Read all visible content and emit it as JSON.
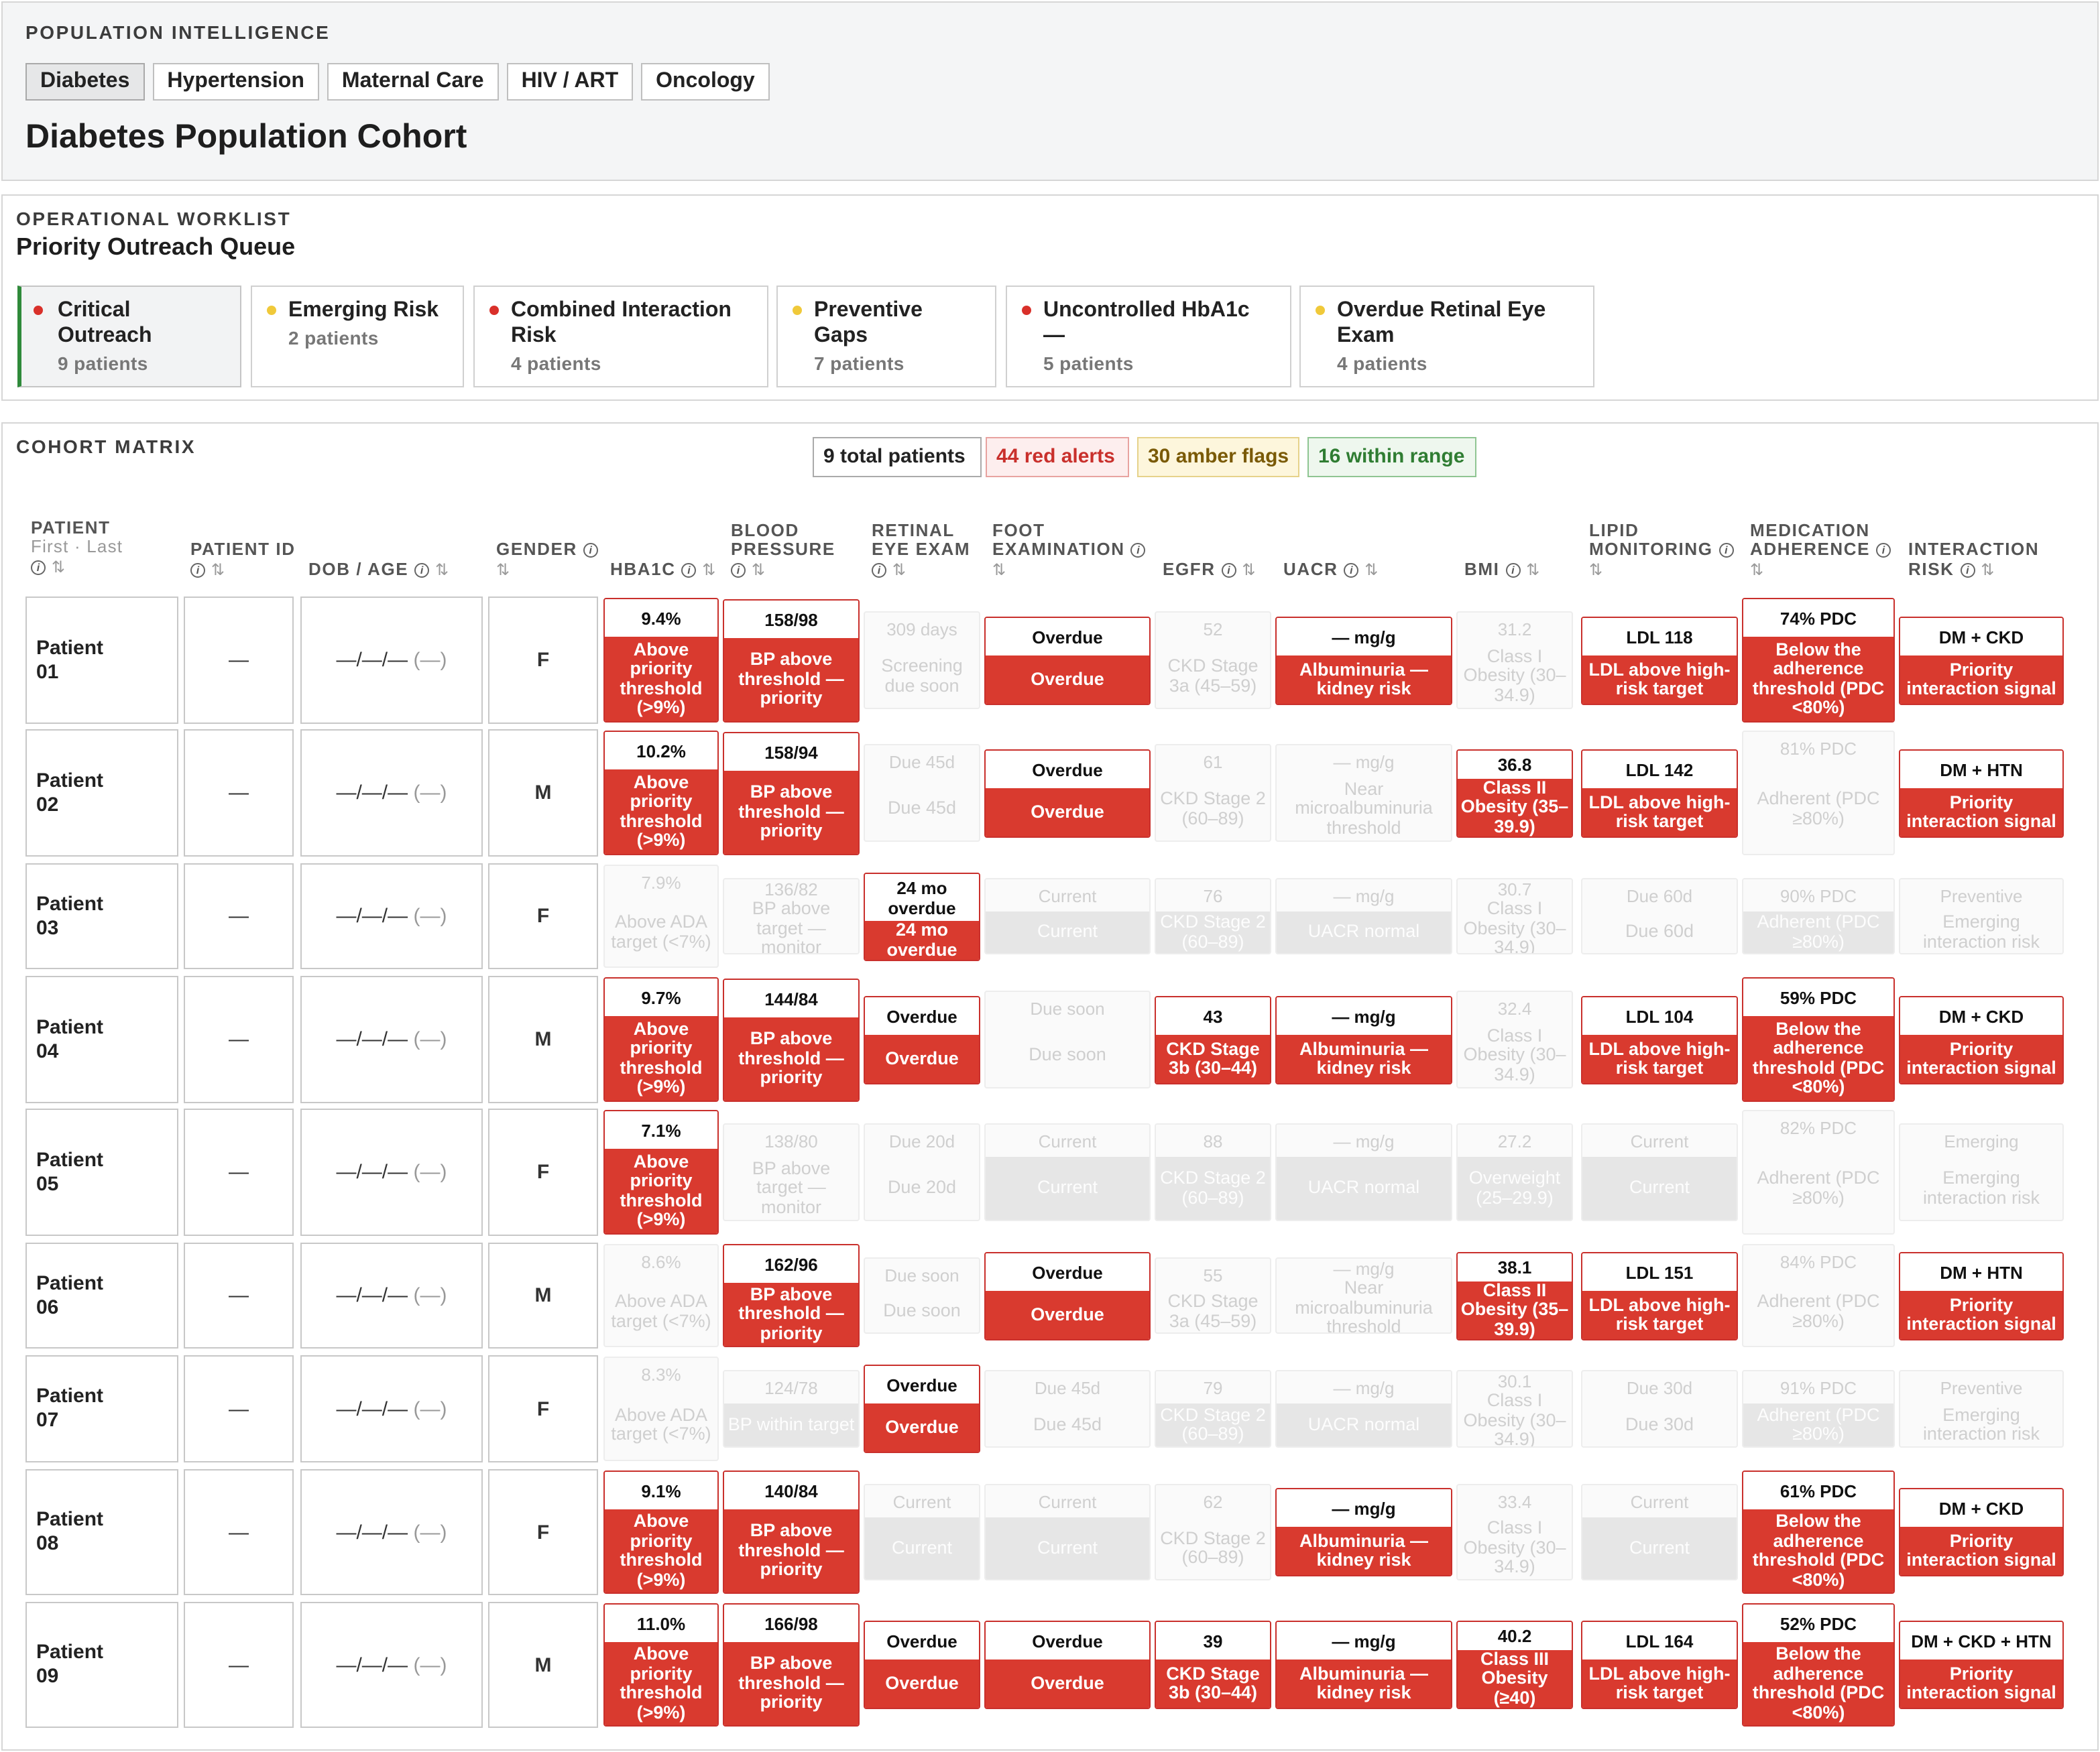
{
  "header": {
    "eyebrow": "POPULATION INTELLIGENCE",
    "title": "Diabetes Population Cohort",
    "tabs": [
      {
        "label": "Diabetes",
        "active": true
      },
      {
        "label": "Hypertension"
      },
      {
        "label": "Maternal Care"
      },
      {
        "label": "HIV / ART"
      },
      {
        "label": "Oncology"
      }
    ]
  },
  "worklist": {
    "eyebrow": "OPERATIONAL WORKLIST",
    "title": "Priority Outreach Queue",
    "queues": [
      {
        "label": "Critical Outreach",
        "count": "9 patients",
        "color": "#d9302a",
        "selected": true
      },
      {
        "label": "Emerging Risk",
        "count": "2 patients",
        "color": "#f0c93a"
      },
      {
        "label": "Combined Interaction Risk",
        "count": "4 patients",
        "color": "#d9302a"
      },
      {
        "label": "Preventive Gaps",
        "count": "7 patients",
        "color": "#f0c93a"
      },
      {
        "label": "Uncontrolled HbA1c —",
        "count": "5 patients",
        "color": "#d9302a"
      },
      {
        "label": "Overdue Retinal Eye Exam",
        "count": "4 patients",
        "color": "#f0c93a"
      }
    ]
  },
  "matrix": {
    "eyebrow": "COHORT MATRIX",
    "summary": [
      {
        "label": "9 total patients",
        "color": "#222",
        "bg": "#ffffff",
        "border": "#aaaaaa"
      },
      {
        "label": "44 red alerts",
        "color": "#c9302c",
        "bg": "#fdeeee",
        "border": "#e8a3a0"
      },
      {
        "label": "30 amber flags",
        "color": "#7a5a06",
        "bg": "#fdf6dc",
        "border": "#e6d28a"
      },
      {
        "label": "16 within range",
        "color": "#2f7d32",
        "bg": "#eef7ee",
        "border": "#8fc592"
      }
    ],
    "columns": [
      {
        "label": "PATIENT",
        "sub": "First · Last"
      },
      {
        "label": "PATIENT ID"
      },
      {
        "label": "DOB / AGE"
      },
      {
        "label": "GENDER"
      },
      {
        "label": "HBA1C"
      },
      {
        "label": "BLOOD PRESSURE"
      },
      {
        "label": "RETINAL EYE EXAM"
      },
      {
        "label": "FOOT EXAMINATION"
      },
      {
        "label": "EGFR"
      },
      {
        "label": "UACR"
      },
      {
        "label": "BMI"
      },
      {
        "label": "LIPID MONITORING"
      },
      {
        "label": "MEDICATION ADHERENCE"
      },
      {
        "label": "INTERACTION RISK"
      }
    ],
    "info_glyph": "i",
    "sort_glyph": "⇅",
    "dash": "—",
    "dob_dash": "—/—/—",
    "age_dash": "(—)",
    "rows": [
      {
        "name": "Patient 01",
        "gender": "F",
        "cells": [
          [
            "red",
            "9.4%",
            "Above priority threshold (>9%)"
          ],
          [
            "red",
            "158/98",
            "BP above threshold — priority"
          ],
          [
            "dim",
            "309 days",
            "Screening due soon"
          ],
          [
            "red",
            "Overdue",
            "Overdue"
          ],
          [
            "dim",
            "52",
            "CKD Stage 3a (45–59)"
          ],
          [
            "red",
            "— mg/g",
            "Albuminuria — kidney risk"
          ],
          [
            "dim",
            "31.2",
            "Class I Obesity (30–34.9)"
          ],
          [
            "red",
            "LDL 118",
            "LDL above high-risk target"
          ],
          [
            "red",
            "74% PDC",
            "Below the adherence threshold (PDC <80%)"
          ],
          [
            "red",
            "DM + CKD",
            "Priority interaction signal"
          ]
        ]
      },
      {
        "name": "Patient 02",
        "gender": "M",
        "cells": [
          [
            "red",
            "10.2%",
            "Above priority threshold (>9%)"
          ],
          [
            "red",
            "158/94",
            "BP above threshold — priority"
          ],
          [
            "dim",
            "Due 45d",
            "Due 45d"
          ],
          [
            "red",
            "Overdue",
            "Overdue"
          ],
          [
            "dim",
            "61",
            "CKD Stage 2 (60–89)"
          ],
          [
            "dim",
            "— mg/g",
            "Near microalbuminuria threshold"
          ],
          [
            "red",
            "36.8",
            "Class II Obesity (35–39.9)"
          ],
          [
            "red",
            "LDL 142",
            "LDL above high-risk target"
          ],
          [
            "dim",
            "81% PDC",
            "Adherent (PDC ≥80%)"
          ],
          [
            "red",
            "DM + HTN",
            "Priority interaction signal"
          ]
        ]
      },
      {
        "name": "Patient 03",
        "gender": "F",
        "cells": [
          [
            "dim",
            "7.9%",
            "Above ADA target (<7%)"
          ],
          [
            "dim",
            "136/82",
            "BP above target — monitor"
          ],
          [
            "red",
            "24 mo overdue",
            "24 mo overdue"
          ],
          [
            "dimf",
            "Current",
            "Current"
          ],
          [
            "dimf",
            "76",
            "CKD Stage 2 (60–89)"
          ],
          [
            "dimf",
            "— mg/g",
            "UACR normal"
          ],
          [
            "dim",
            "30.7",
            "Class I Obesity (30–34.9)"
          ],
          [
            "dim",
            "Due 60d",
            "Due 60d"
          ],
          [
            "dimf",
            "90% PDC",
            "Adherent (PDC ≥80%)"
          ],
          [
            "dim",
            "Preventive",
            "Emerging interaction risk"
          ]
        ]
      },
      {
        "name": "Patient 04",
        "gender": "M",
        "cells": [
          [
            "red",
            "9.7%",
            "Above priority threshold (>9%)"
          ],
          [
            "red",
            "144/84",
            "BP above threshold — priority"
          ],
          [
            "red",
            "Overdue",
            "Overdue"
          ],
          [
            "dim",
            "Due soon",
            "Due soon"
          ],
          [
            "red",
            "43",
            "CKD Stage 3b (30–44)"
          ],
          [
            "red",
            "— mg/g",
            "Albuminuria — kidney risk"
          ],
          [
            "dim",
            "32.4",
            "Class I Obesity (30–34.9)"
          ],
          [
            "red",
            "LDL 104",
            "LDL above high-risk target"
          ],
          [
            "red",
            "59% PDC",
            "Below the adherence threshold (PDC <80%)"
          ],
          [
            "red",
            "DM + CKD",
            "Priority interaction signal"
          ]
        ]
      },
      {
        "name": "Patient 05",
        "gender": "F",
        "cells": [
          [
            "red",
            "7.1%",
            "Above priority threshold (>9%)"
          ],
          [
            "dim",
            "138/80",
            "BP above target — monitor"
          ],
          [
            "dim",
            "Due 20d",
            "Due 20d"
          ],
          [
            "dimf",
            "Current",
            "Current"
          ],
          [
            "dimf",
            "88",
            "CKD Stage 2 (60–89)"
          ],
          [
            "dimf",
            "— mg/g",
            "UACR normal"
          ],
          [
            "dimf",
            "27.2",
            "Overweight (25–29.9)"
          ],
          [
            "dimf",
            "Current",
            "Current"
          ],
          [
            "dim",
            "82% PDC",
            "Adherent (PDC ≥80%)"
          ],
          [
            "dim",
            "Emerging",
            "Emerging interaction risk"
          ]
        ]
      },
      {
        "name": "Patient 06",
        "gender": "M",
        "cells": [
          [
            "dim",
            "8.6%",
            "Above ADA target (<7%)"
          ],
          [
            "red",
            "162/96",
            "BP above threshold — priority"
          ],
          [
            "dim",
            "Due soon",
            "Due soon"
          ],
          [
            "red",
            "Overdue",
            "Overdue"
          ],
          [
            "dim",
            "55",
            "CKD Stage 3a (45–59)"
          ],
          [
            "dim",
            "— mg/g",
            "Near microalbuminuria threshold"
          ],
          [
            "red",
            "38.1",
            "Class II Obesity (35–39.9)"
          ],
          [
            "red",
            "LDL 151",
            "LDL above high-risk target"
          ],
          [
            "dim",
            "84% PDC",
            "Adherent (PDC ≥80%)"
          ],
          [
            "red",
            "DM + HTN",
            "Priority interaction signal"
          ]
        ]
      },
      {
        "name": "Patient 07",
        "gender": "F",
        "cells": [
          [
            "dim",
            "8.3%",
            "Above ADA target (<7%)"
          ],
          [
            "dimf",
            "124/78",
            "BP within target"
          ],
          [
            "red",
            "Overdue",
            "Overdue"
          ],
          [
            "dim",
            "Due 45d",
            "Due 45d"
          ],
          [
            "dimf",
            "79",
            "CKD Stage 2 (60–89)"
          ],
          [
            "dimf",
            "— mg/g",
            "UACR normal"
          ],
          [
            "dim",
            "30.1",
            "Class I Obesity (30–34.9)"
          ],
          [
            "dim",
            "Due 30d",
            "Due 30d"
          ],
          [
            "dimf",
            "91% PDC",
            "Adherent (PDC ≥80%)"
          ],
          [
            "dim",
            "Preventive",
            "Emerging interaction risk"
          ]
        ]
      },
      {
        "name": "Patient 08",
        "gender": "F",
        "cells": [
          [
            "red",
            "9.1%",
            "Above priority threshold (>9%)"
          ],
          [
            "red",
            "140/84",
            "BP above threshold — priority"
          ],
          [
            "dimf",
            "Current",
            "Current"
          ],
          [
            "dimf",
            "Current",
            "Current"
          ],
          [
            "dim",
            "62",
            "CKD Stage 2 (60–89)"
          ],
          [
            "red",
            "— mg/g",
            "Albuminuria — kidney risk"
          ],
          [
            "dim",
            "33.4",
            "Class I Obesity (30–34.9)"
          ],
          [
            "dimf",
            "Current",
            "Current"
          ],
          [
            "red",
            "61% PDC",
            "Below the adherence threshold (PDC <80%)"
          ],
          [
            "red",
            "DM + CKD",
            "Priority interaction signal"
          ]
        ]
      },
      {
        "name": "Patient 09",
        "gender": "M",
        "cells": [
          [
            "red",
            "11.0%",
            "Above priority threshold (>9%)"
          ],
          [
            "red",
            "166/98",
            "BP above threshold — priority"
          ],
          [
            "red",
            "Overdue",
            "Overdue"
          ],
          [
            "red",
            "Overdue",
            "Overdue"
          ],
          [
            "red",
            "39",
            "CKD Stage 3b (30–44)"
          ],
          [
            "red",
            "— mg/g",
            "Albuminuria — kidney risk"
          ],
          [
            "red",
            "40.2",
            "Class III Obesity (≥40)"
          ],
          [
            "red",
            "LDL 164",
            "LDL above high-risk target"
          ],
          [
            "red",
            "52% PDC",
            "Below the adherence threshold (PDC <80%)"
          ],
          [
            "red",
            "DM + CKD + HTN",
            "Priority interaction signal"
          ]
        ]
      }
    ]
  }
}
